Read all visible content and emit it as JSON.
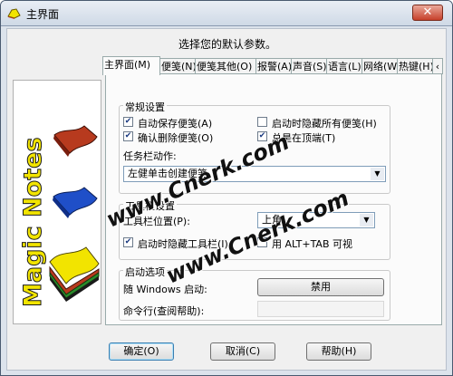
{
  "window": {
    "title": "主界面",
    "close_label": "✕"
  },
  "header": {
    "text": "选择您的默认参数。"
  },
  "tabs": [
    {
      "label": "主界面(M)"
    },
    {
      "label": "便笺(N)"
    },
    {
      "label": "便笺其他(O)"
    },
    {
      "label": "报警(A)"
    },
    {
      "label": "声音(S)"
    },
    {
      "label": "语言(L)"
    },
    {
      "label": "网络(W)"
    },
    {
      "label": "热键(H)"
    },
    {
      "label": "‹"
    }
  ],
  "logo": {
    "text": "Magic Notes",
    "colors": {
      "red": "#b73a1e",
      "blue": "#1f4fc8",
      "yellow": "#f2e400"
    }
  },
  "general": {
    "title": "常规设置",
    "autosave_label": "自动保存便笺(A)",
    "autosave_checked": true,
    "hide_all_label": "启动时隐藏所有便笺(H)",
    "hide_all_checked": false,
    "confirm_delete_label": "确认删除便笺(O)",
    "confirm_delete_checked": true,
    "on_top_label": "总是在顶端(T)",
    "on_top_checked": true,
    "taskbar_label": "任务栏动作:",
    "taskbar_value": "左健单击创建便笺"
  },
  "toolbar": {
    "title": "工具栏设置",
    "position_label": "工具栏位置(P):",
    "position_value": "上角",
    "hide_label": "启动时隐藏工具栏(I)",
    "hide_checked": true,
    "alttab_label": "用 ALT+TAB 可视",
    "alttab_checked": false
  },
  "startup": {
    "title": "启动选项",
    "windows_label": "随 Windows 启动:",
    "windows_button": "禁用",
    "cmdline_label": "命令行(查阅帮助):",
    "cmdline_value": ""
  },
  "buttons": {
    "ok": "确定(O)",
    "cancel": "取消(C)",
    "help": "帮助(H)"
  },
  "watermark": {
    "text": "www.Cnerk.com"
  }
}
